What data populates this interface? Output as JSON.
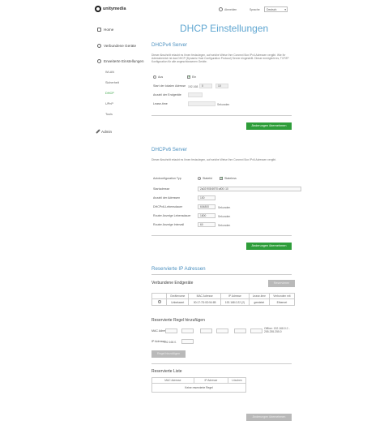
{
  "header": {
    "brand": "unitymedia",
    "logout_label": "Abmelden",
    "language_label": "Sprache",
    "language_value": "Deutsch"
  },
  "sidebar": {
    "items": [
      {
        "label": "Home",
        "icon": "home-icon"
      },
      {
        "label": "Verbundene Geräte",
        "icon": "devices-icon"
      },
      {
        "label": "Erweiterte Einstellungen",
        "icon": "settings-icon"
      }
    ],
    "subitems": [
      "WLAN",
      "Sicherheit",
      "DHCP",
      "UPnP",
      "Tools"
    ],
    "active_subitem": "DHCP",
    "admin_label": "Admin"
  },
  "page_title": "DHCP Einstellungen",
  "ipv4": {
    "title": "DHCPv4 Server",
    "description": "Dieser Abschnitt erlaubt es Ihnen festzulegen, auf welche Weise Ihre Connect Box IPv4 Adressen vergibt. Wie Ihr Adressbereich ist das DHCP (Dynamic Host Configuration Protocol) Server eingestellt. Dieser ermöglicht es, TCP/IP Konfiguration für alle angeschlossenen Geräte.",
    "option_off": "Aus",
    "option_on": "Ein",
    "start_label": "Start der lokalen Adresse",
    "start_prefix": "192.168.",
    "start_octet3": "0",
    "start_octet4": "10",
    "end_label": "Anzahl der Endgeräte",
    "end_value": "",
    "lease_label": "Lease-time",
    "lease_value": "",
    "lease_unit": "Sekunden",
    "apply_label": "Änderungen übernehmen"
  },
  "ipv6": {
    "title": "DHCPv6 Server",
    "description": "Dieser Abschnitt erlaubt es Ihnen festzulegen, auf welche Weise Ihre Connect Box IPv6 Adressen vergibt.",
    "config_label": "Autokonfiguration Typ",
    "option_stateful": "Stateful",
    "option_stateless": "Stateless",
    "prefix_label": "Startadresse",
    "prefix_value": "2a02:908:6970:af00::10",
    "count_label": "Anzahl der Adressen",
    "count_value": "100",
    "lifetime_label": "DHCPv6-Lebensdauer",
    "lifetime_value": "604800",
    "ra_label": "Router Anzeige Lebensdauer",
    "ra_value": "1800",
    "interval_label": "Router Anzeige Intervall",
    "interval_value": "60",
    "unit": "Sekunden",
    "apply_label": "Änderungen übernehmen"
  },
  "reserved": {
    "title": "Reservierte IP Adressen",
    "connected_title": "Verbundene Endgeräte",
    "reserve_button": "Reservieren",
    "columns": [
      "",
      "Gerätename",
      "MAC Adresse",
      "IP Adresse",
      "Lease-time",
      "Verbunden mit"
    ],
    "rows": [
      {
        "name": "Unbekannt",
        "mac": "00:17:7D:0D:54:85",
        "ip": "192.168.0.22 (2)",
        "lease": "gemietet",
        "via": "Ethernet"
      }
    ],
    "add_title": "Reservierte Regel hinzufügen",
    "mac_label": "MAC Adresse",
    "ip_label": "IP Adresse",
    "ip_prefix": "192.168.0.",
    "hint": "Offline: 192.168.0.2 - 255.255.255.0",
    "add_button": "Regel hinzufügen",
    "list_title": "Reservierte Liste",
    "list_columns": [
      "MAC Adresse",
      "IP Adresse",
      "Löschen"
    ],
    "empty_text": "Keine reservierte Regel",
    "apply_label": "Änderungen übernehmen"
  }
}
